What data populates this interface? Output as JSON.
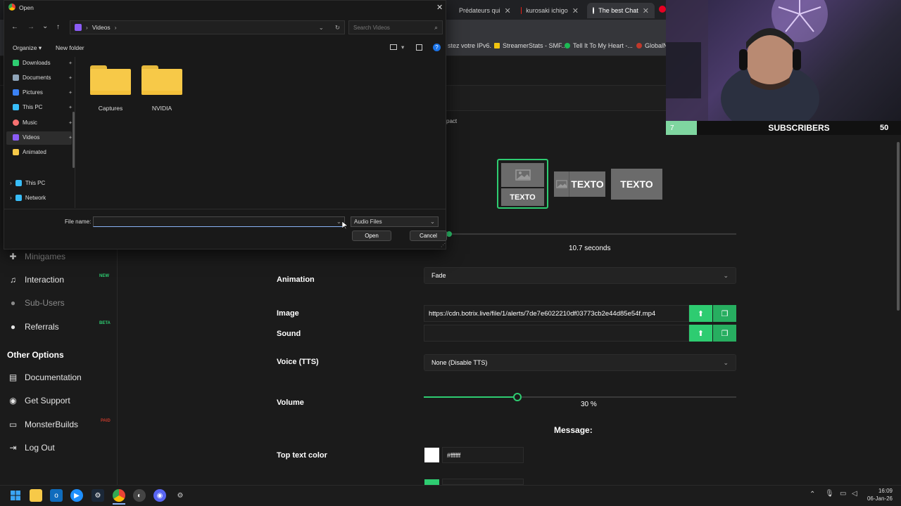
{
  "browser": {
    "tabs": [
      {
        "label": "Prédateurs qui"
      },
      {
        "label": "kurosaki ichigo"
      },
      {
        "label": "The best Chat"
      }
    ],
    "bookmarks": [
      {
        "label": "stez votre IPv6."
      },
      {
        "label": "StreamerStats - SMF..."
      },
      {
        "label": "Tell It To My Heart -..."
      },
      {
        "label": "GlobalN"
      }
    ]
  },
  "app": {
    "partial_label": "pact",
    "sidebar": {
      "items": [
        {
          "label": "Minigames",
          "icon": "puzzle-icon",
          "dim": true
        },
        {
          "label": "Interaction",
          "icon": "music-icon",
          "badge": "NEW"
        },
        {
          "label": "Sub-Users",
          "icon": "users-icon",
          "dim": true
        },
        {
          "label": "Referrals",
          "icon": "users-icon",
          "badge": "BETA"
        }
      ],
      "section_title": "Other Options",
      "options": [
        {
          "label": "Documentation",
          "icon": "book-icon"
        },
        {
          "label": "Get Support",
          "icon": "support-icon"
        },
        {
          "label": "MonsterBuilds",
          "icon": "monitor-icon",
          "badge": "PAID"
        },
        {
          "label": "Log Out",
          "icon": "logout-icon"
        }
      ]
    },
    "layouts": {
      "text": "TEXTO"
    },
    "duration": {
      "value": "10.7",
      "unit": "seconds"
    },
    "animation": {
      "label": "Animation",
      "value": "Fade"
    },
    "image": {
      "label": "Image",
      "value": "https://cdn.botrix.live/file/1/alerts/7de7e6022210df03773cb2e44d85e54f.mp4"
    },
    "sound": {
      "label": "Sound",
      "value": ""
    },
    "voice": {
      "label": "Voice (TTS)",
      "value": "None (Disable TTS)"
    },
    "volume": {
      "label": "Volume",
      "value": "30",
      "unit": "%",
      "fraction": 0.3
    },
    "message": {
      "title": "Message:"
    },
    "top_text_color": {
      "label": "Top text color",
      "value": "#ffffff"
    }
  },
  "webcam": {
    "subscribers_label": "SUBSCRIBERS",
    "left_value": "7",
    "right_value": "50"
  },
  "dialog": {
    "title": "Open",
    "path_folder": "Videos",
    "search_placeholder": "Search Videos",
    "organize": "Organize",
    "new_folder": "New folder",
    "nav": [
      {
        "label": "Downloads",
        "pinned": true
      },
      {
        "label": "Documents",
        "pinned": true
      },
      {
        "label": "Pictures",
        "pinned": true
      },
      {
        "label": "This PC",
        "pinned": true
      },
      {
        "label": "Music",
        "pinned": true
      },
      {
        "label": "Videos",
        "pinned": true
      },
      {
        "label": "Animated",
        "pinned": false
      }
    ],
    "nav_tree": [
      {
        "label": "This PC"
      },
      {
        "label": "Network"
      }
    ],
    "folders": [
      {
        "label": "Captures"
      },
      {
        "label": "NVIDIA"
      }
    ],
    "file_name_label": "File name:",
    "file_name_value": "",
    "file_type": "Audio Files",
    "open_label": "Open",
    "cancel_label": "Cancel"
  },
  "taskbar": {
    "time": "16:09",
    "date": "06-Jan-26"
  },
  "colors": {
    "accent": "#2ecc71",
    "selected_border": "#2ecc71"
  }
}
